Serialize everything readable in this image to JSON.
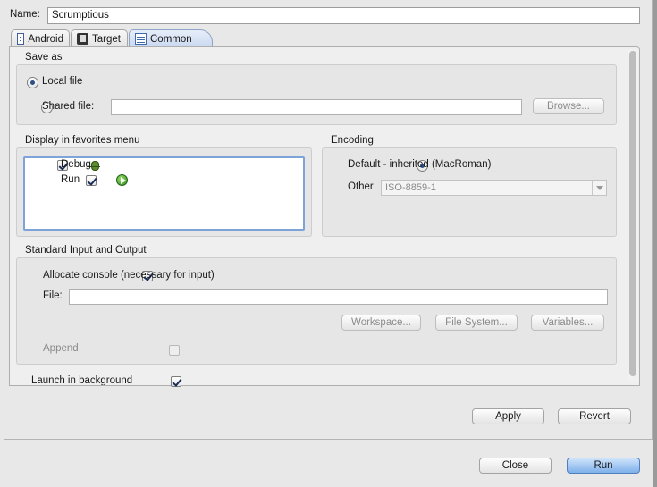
{
  "config": {
    "name_label": "Name:",
    "name_value": "Scrumptious"
  },
  "tabs": [
    {
      "label": "Android",
      "icon": "android-doc-icon"
    },
    {
      "label": "Target",
      "icon": "target-icon"
    },
    {
      "label": "Common",
      "icon": "common-icon",
      "active": true
    }
  ],
  "save_as": {
    "title": "Save as",
    "local_label": "Local file",
    "shared_label": "Shared file:",
    "shared_value": "",
    "browse_label": "Browse...",
    "selected": "local"
  },
  "favorites": {
    "title": "Display in favorites menu",
    "items": [
      {
        "label": "Debug",
        "checked": true,
        "icon": "debug-bug-icon"
      },
      {
        "label": "Run",
        "checked": true,
        "icon": "run-play-icon"
      }
    ]
  },
  "encoding": {
    "title": "Encoding",
    "default_label": "Default - inherited (MacRoman)",
    "other_label": "Other",
    "other_value": "ISO-8859-1",
    "selected": "default"
  },
  "std_io": {
    "title": "Standard Input and Output",
    "allocate_label": "Allocate console (necessary for input)",
    "allocate_checked": true,
    "file_label": "File:",
    "file_value": "",
    "file_checked": false,
    "workspace_label": "Workspace...",
    "filesystem_label": "File System...",
    "variables_label": "Variables...",
    "append_label": "Append",
    "append_checked": false
  },
  "launch_background": {
    "label": "Launch in background",
    "checked": true
  },
  "actions": {
    "apply_label": "Apply",
    "revert_label": "Revert",
    "close_label": "Close",
    "run_label": "Run"
  },
  "colors": {
    "accent": "#7fb0ea",
    "active_tab": "#c9d8ef"
  }
}
